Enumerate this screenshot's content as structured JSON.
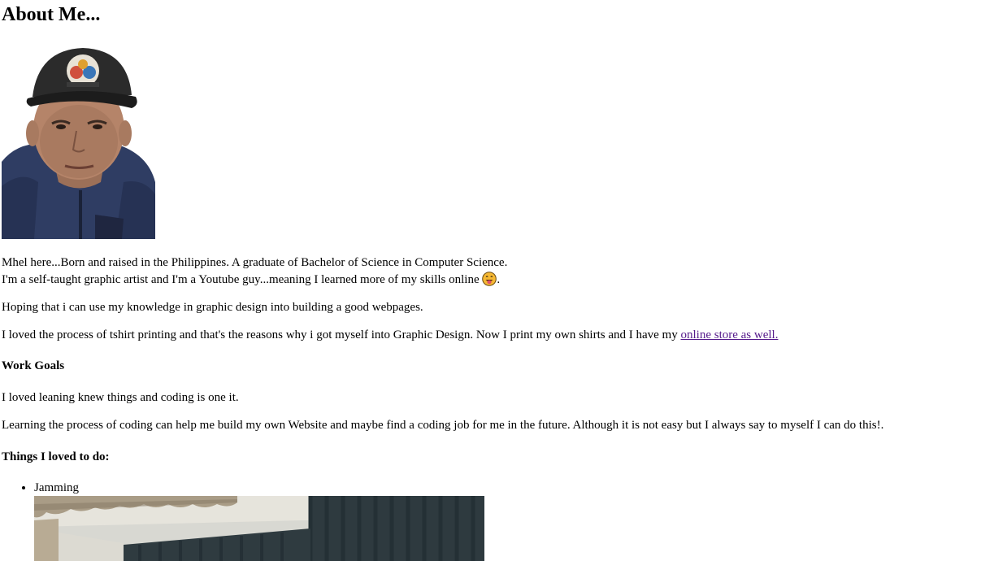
{
  "page": {
    "title": "About Me...",
    "portrait_alt": "portrait photo",
    "intro_line1": "Mhel here...Born and raised in the Philippines. A graduate of Bachelor of Science in Computer Science.",
    "intro_line2": "I'm a self-taught graphic artist and I'm a Youtube guy...meaning I learned more of my skills online",
    "intro_line2_end": ".",
    "emoji_icon": "tongue-out-face-icon",
    "paragraph2": "Hoping that i can use my knowledge in graphic design into building a good webpages.",
    "paragraph3_text": "I loved the process of tshirt printing and that's the reasons why i got myself into Graphic Design. Now I print my own shirts and I have my ",
    "store_link": "online store as well.",
    "work_goals_heading": "Work Goals",
    "paragraph4": "I loved leaning knew things and coding is one it.",
    "paragraph5": "Learning the process of coding can help me build my own Website and maybe find a coding job for me in the future. Although it is not easy but I always say to myself I can do this!.",
    "things_heading": "Things I loved to do:",
    "loves": [
      {
        "label": "Jamming"
      }
    ]
  },
  "colors": {
    "link_visited": "#551a8b",
    "text": "#000000",
    "background": "#ffffff"
  }
}
